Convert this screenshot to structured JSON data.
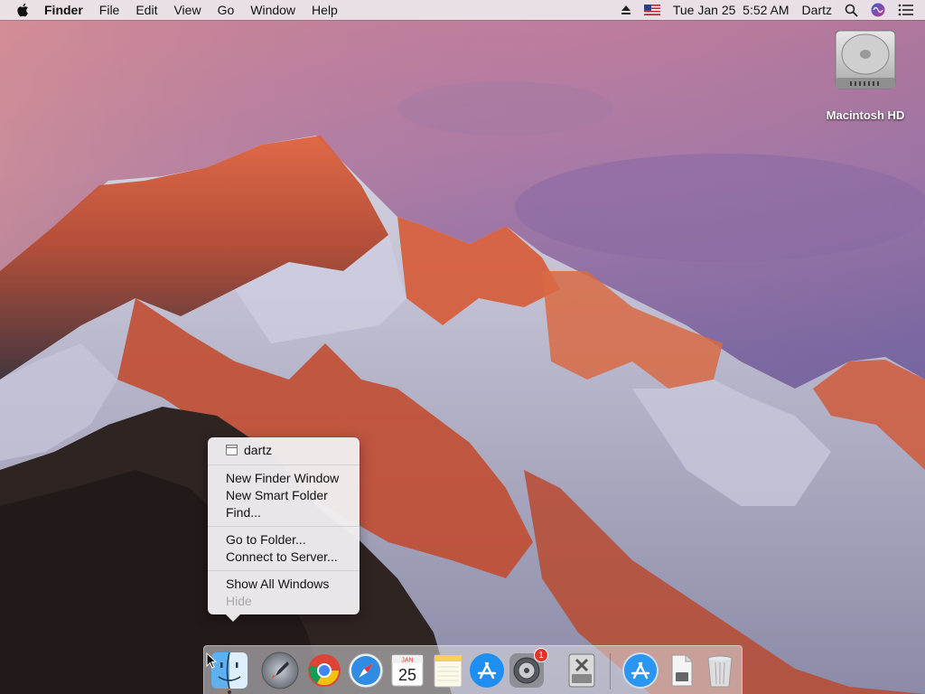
{
  "menubar": {
    "app_name": "Finder",
    "menus": [
      "File",
      "Edit",
      "View",
      "Go",
      "Window",
      "Help"
    ],
    "datetime": "Tue Jan 25  5:52 AM",
    "user": "Dartz"
  },
  "desktop": {
    "drive_label": "Macintosh HD"
  },
  "context_menu": {
    "header": "dartz",
    "group1": [
      "New Finder Window",
      "New Smart Folder",
      "Find..."
    ],
    "group2": [
      "Go to Folder...",
      "Connect to Server..."
    ],
    "group3": [
      "Show All Windows",
      "Hide"
    ]
  },
  "dock": {
    "calendar_month": "JAN",
    "calendar_day": "25",
    "sysprefs_badge": "1",
    "items": [
      "finder",
      "launchpad",
      "chrome",
      "safari",
      "calendar",
      "notes",
      "app-store",
      "system-preferences",
      "disk-utility",
      "app-store-installer",
      "document",
      "trash"
    ]
  },
  "colors": {
    "menu_disabled": "#a9a6a9",
    "badge": "#e5352b"
  }
}
